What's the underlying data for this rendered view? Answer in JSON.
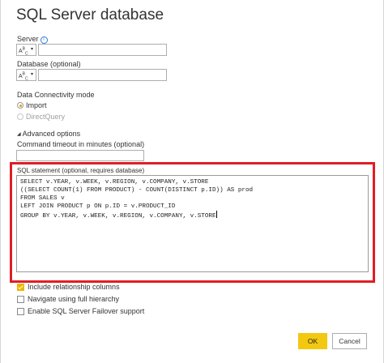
{
  "dialog": {
    "title": "SQL Server database",
    "server": {
      "label": "Server",
      "type_button": "ABC",
      "value": ""
    },
    "database": {
      "label": "Database (optional)",
      "type_button": "ABC",
      "value": ""
    },
    "connectivity": {
      "label": "Data Connectivity mode",
      "options": [
        {
          "label": "Import",
          "selected": true
        },
        {
          "label": "DirectQuery",
          "selected": false
        }
      ]
    },
    "advanced": {
      "toggle_label": "Advanced options",
      "timeout_label": "Command timeout in minutes (optional)",
      "timeout_value": "",
      "sql_label": "SQL statement (optional, requires database)",
      "sql_lines": [
        "SELECT v.YEAR, v.WEEK, v.REGION, v.COMPANY, v.STORE",
        "((SELECT COUNT(1) FROM PRODUCT) - COUNT(DISTINCT p.ID)) AS prod",
        "FROM SALES v",
        "LEFT JOIN PRODUCT p ON p.ID = v.PRODUCT_ID",
        "GROUP BY v.YEAR, v.WEEK, v.REGION, v.COMPANY, v.STORE"
      ],
      "checkboxes": [
        {
          "label": "Include relationship columns",
          "checked": true
        },
        {
          "label": "Navigate using full hierarchy",
          "checked": false
        },
        {
          "label": "Enable SQL Server Failover support",
          "checked": false
        }
      ]
    },
    "buttons": {
      "ok": "OK",
      "cancel": "Cancel"
    },
    "colors": {
      "highlight": "#e01e24",
      "accent": "#f2c811"
    }
  }
}
